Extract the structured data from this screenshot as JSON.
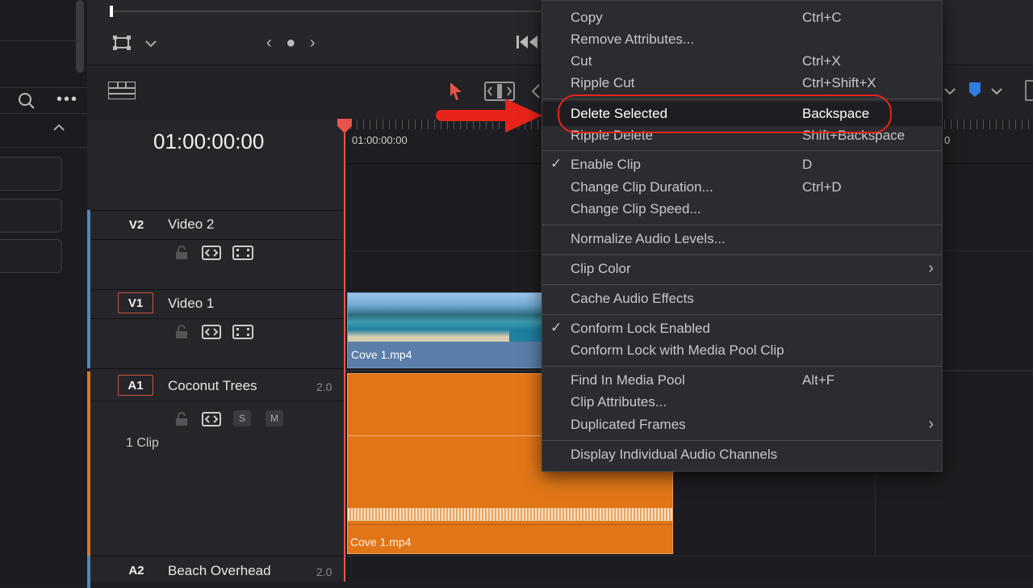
{
  "viewer": {
    "nav_left": "‹ ● ›"
  },
  "timecode": "01:00:00:00",
  "ruler_label": "01:00:00:00",
  "ruler_right_digit": "0",
  "tracks": {
    "v2": {
      "badge": "V2",
      "name": "Video 2"
    },
    "v1": {
      "badge": "V1",
      "name": "Video 1"
    },
    "a1": {
      "badge": "A1",
      "name": "Coconut Trees",
      "vol": "2.0",
      "solo": "S",
      "mute": "M",
      "clips": "1 Clip"
    },
    "a2": {
      "badge": "A2",
      "name": "Beach Overhead",
      "vol": "2.0"
    }
  },
  "clips": {
    "video": "Cove 1.mp4",
    "audio": "Cove 1.mp4"
  },
  "menu": {
    "copy": {
      "label": "Copy",
      "shortcut": "Ctrl+C"
    },
    "remove_attr": {
      "label": "Remove Attributes..."
    },
    "cut": {
      "label": "Cut",
      "shortcut": "Ctrl+X"
    },
    "ripple_cut": {
      "label": "Ripple Cut",
      "shortcut": "Ctrl+Shift+X"
    },
    "delete_selected": {
      "label": "Delete Selected",
      "shortcut": "Backspace"
    },
    "ripple_delete": {
      "label": "Ripple Delete",
      "shortcut": "Shift+Backspace"
    },
    "enable_clip": {
      "label": "Enable Clip",
      "shortcut": "D",
      "check": "✓"
    },
    "change_duration": {
      "label": "Change Clip Duration...",
      "shortcut": "Ctrl+D"
    },
    "change_speed": {
      "label": "Change Clip Speed..."
    },
    "normalize": {
      "label": "Normalize Audio Levels..."
    },
    "clip_color": {
      "label": "Clip Color",
      "arrow": "›"
    },
    "cache_audio": {
      "label": "Cache Audio Effects"
    },
    "conform_lock": {
      "label": "Conform Lock Enabled",
      "check": "✓"
    },
    "conform_lock_pool": {
      "label": "Conform Lock with Media Pool Clip"
    },
    "find_pool": {
      "label": "Find In Media Pool",
      "shortcut": "Alt+F"
    },
    "clip_attributes": {
      "label": "Clip Attributes..."
    },
    "duplicated_frames": {
      "label": "Duplicated Frames",
      "arrow": "›"
    },
    "display_audio": {
      "label": "Display Individual Audio Channels"
    }
  },
  "colors": {
    "accent_red": "#e8241a",
    "audio_clip": "#e07618",
    "video_clip": "#5a7fa8",
    "playhead": "#e8544a"
  }
}
